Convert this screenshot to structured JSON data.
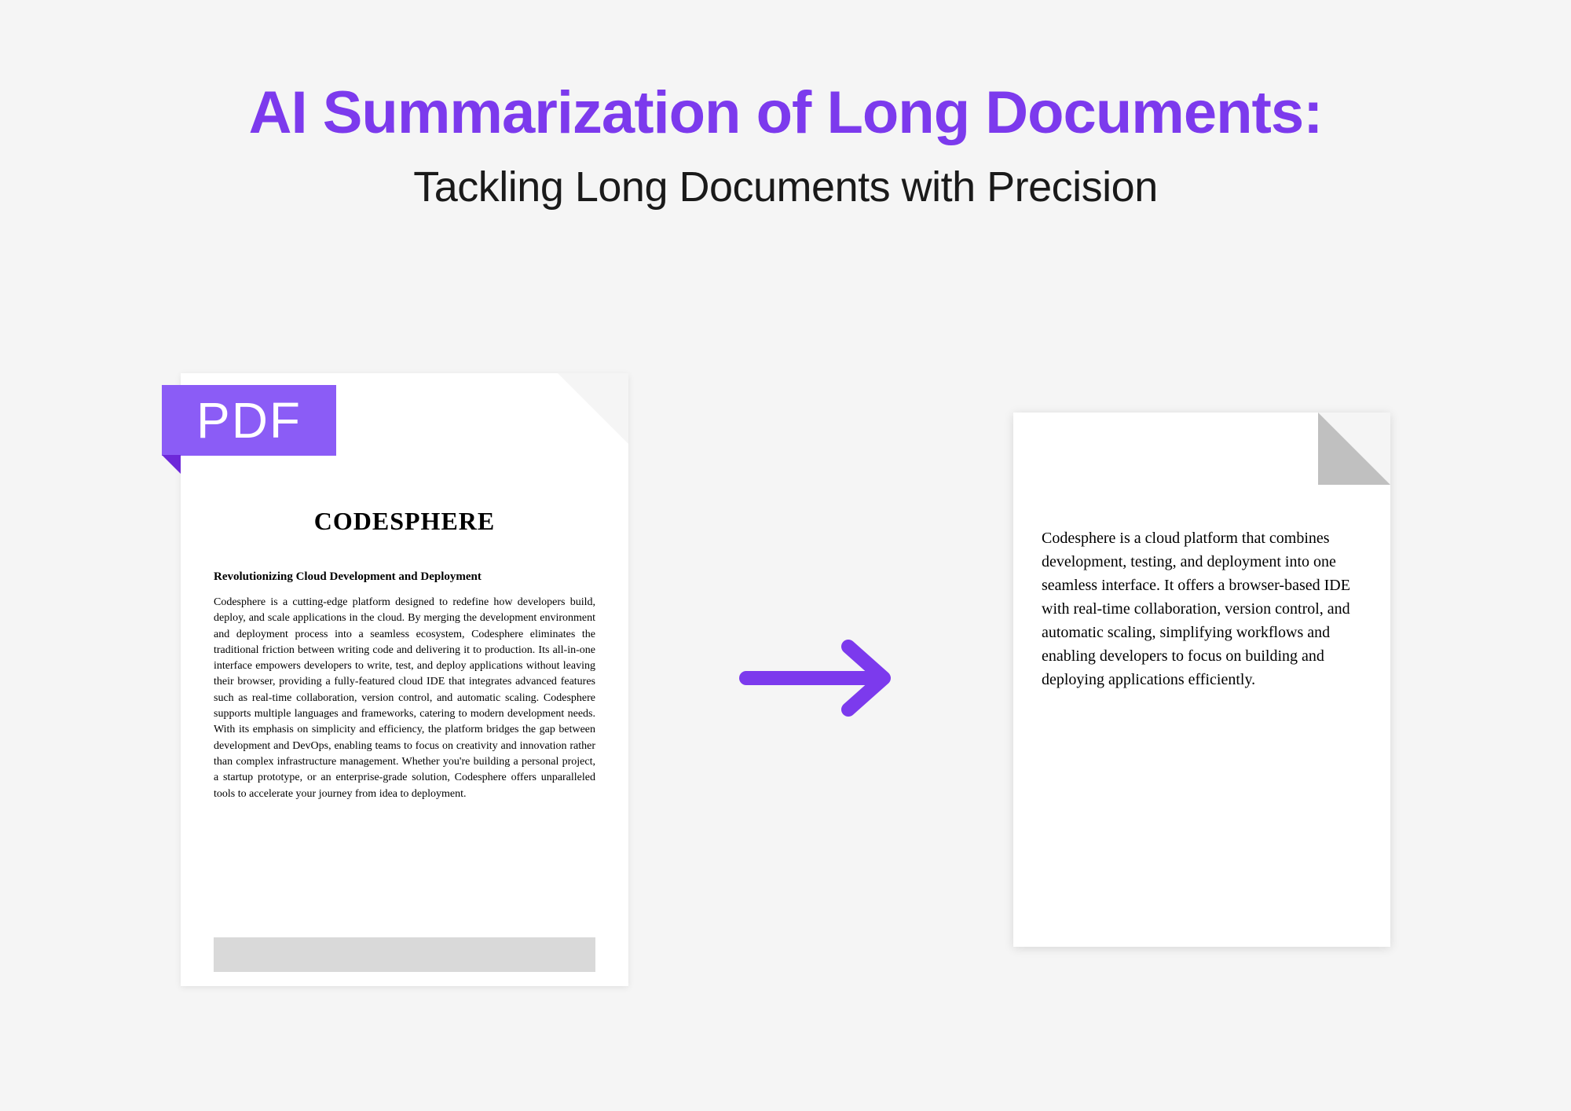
{
  "header": {
    "title": "AI Summarization of Long Documents:",
    "subtitle": "Tackling Long Documents with Precision"
  },
  "pdf": {
    "badge": "PDF",
    "doc_title": "CODESPHERE",
    "doc_subtitle": "Revolutionizing Cloud Development and Deployment",
    "doc_body": "Codesphere is a cutting-edge platform designed to redefine how developers build, deploy, and scale applications in the cloud. By merging the development environment and deployment process into a seamless ecosystem, Codesphere eliminates the traditional friction between writing code and delivering it to production. Its all-in-one interface empowers developers to write, test, and deploy applications without leaving their browser, providing a fully-featured cloud IDE that integrates advanced features such as real-time collaboration, version control, and automatic scaling. Codesphere supports multiple languages and frameworks, catering to modern development needs. With its emphasis on simplicity and efficiency, the platform bridges the gap between development and DevOps, enabling teams to focus on creativity and innovation rather than complex infrastructure management. Whether you're building a personal project, a startup prototype, or an enterprise-grade solution, Codesphere offers unparalleled tools to accelerate your journey from idea to deployment."
  },
  "summary": {
    "text": "Codesphere is a cloud platform that combines development, testing, and deployment into one seamless interface. It offers a browser-based IDE with real-time collaboration, version control, and automatic scaling, simplifying workflows and enabling developers to focus on building and deploying applications efficiently."
  },
  "colors": {
    "accent": "#7c3aed",
    "badge": "#8B5CF6"
  }
}
